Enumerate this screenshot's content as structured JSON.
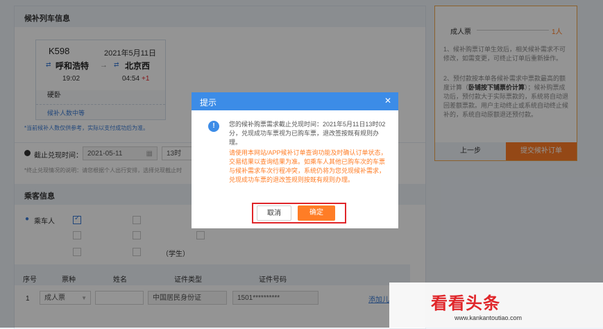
{
  "train_info": {
    "section_title": "候补列车信息",
    "train_no": "K598",
    "date": "2021年5月11日",
    "from_station": "呼和浩特",
    "to_station": "北京西",
    "depart_time": "19:02",
    "arrive_time": "04:54",
    "plus_days": "+1",
    "seat_type": "硬卧",
    "queue_link": "候补人数中等",
    "note": "*当前候补人数仅供参考，实际以支付成功后为准。"
  },
  "deadline": {
    "label": "截止兑现时间：",
    "date_value": "2021-05-11",
    "hour_value": "13时",
    "note": "*终止兑现情况的说明：请您根据个人出行安排，选择兑现截止时"
  },
  "passenger": {
    "section_title": "乘客信息",
    "label": "乘车人",
    "student_label": "（学生）",
    "table_headers": [
      "序号",
      "票种",
      "姓名",
      "证件类型",
      "证件号码"
    ],
    "row": {
      "index": "1",
      "ticket_type": "成人票",
      "name": "",
      "id_type": "中国居民身份证",
      "id_number": "1501**********",
      "add_link": "添加儿"
    }
  },
  "summary": {
    "ticket_label": "成人票",
    "ticket_count": "1人",
    "note1": "1、候补购票订单生效后，相关候补需求不可修改，如需变更，可终止订单后重新操作。",
    "note2_a": "2、预付款按本单各候补需求中票款最高的额度计算（",
    "note2_bold": "卧铺按下铺票价计算",
    "note2_b": "）；候补购票成功后，预付款大于实际票款的，系统将自动退回差额票款。用户主动终止或系统自动终止候补的，系统自动原额退还预付款。",
    "prev_button": "上一步",
    "submit_button": "提交候补订单"
  },
  "dialog": {
    "title": "提示",
    "close_glyph": "✕",
    "info_icon_glyph": "!",
    "message": "您的候补购票需求截止兑现时间：2021年5月11日13时02分，兑现成功车票视为已购车票，退改签按既有规则办理。",
    "warning": "请使用本网站/APP候补订单查询功能及时确认订单状态，交易结果以查询结果为准。如乘车人其他已购车次的车票与候补需求车次行程冲突，系统仍将为您兑现候补需求，兑现成功车票的退改签规则按既有规则办理。",
    "cancel_button": "取消",
    "confirm_button": "确定"
  },
  "watermark": {
    "brand": "看看头条",
    "url": "www.kankantoutiao.com"
  },
  "colors": {
    "primary_blue": "#3c8ce7",
    "orange": "#ff7d26",
    "highlight_red": "#e0262a",
    "overlay": "rgba(0,0,0,0.42)"
  }
}
